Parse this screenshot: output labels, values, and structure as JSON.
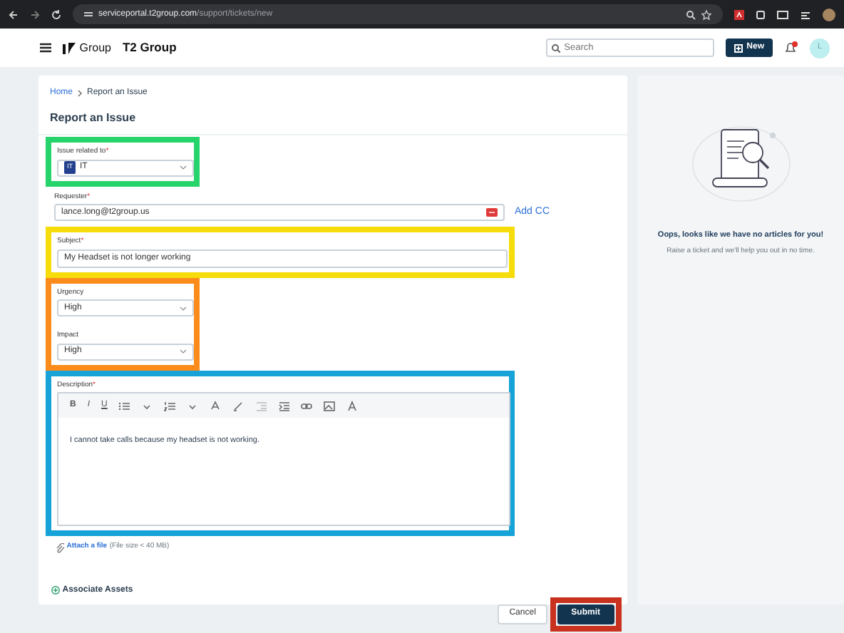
{
  "browser": {
    "url_host": "serviceportal.t2group.com",
    "url_path": "/support/tickets/new"
  },
  "header": {
    "logo_text": "Group",
    "title": "T2 Group",
    "search": {
      "placeholder": "Search"
    },
    "new_button": "New",
    "avatar_initial": "L"
  },
  "breadcrumb": [
    {
      "label": "Home",
      "kind": "link"
    },
    {
      "label": "Report an Issue",
      "kind": "current"
    }
  ],
  "page_title": "Report an Issue",
  "sections": [
    {
      "color": "#27d36b",
      "fields": [
        {
          "kind": "select",
          "label": "Issue related to",
          "mark": "*",
          "badge": "IT",
          "value": "IT"
        }
      ]
    },
    {
      "fields": [
        {
          "kind": "email",
          "label": "Requester",
          "mark": "*",
          "value": "lance.long@t2group.us",
          "action": "Add CC"
        }
      ]
    },
    {
      "color": "#f5dc0a",
      "fields": [
        {
          "kind": "text",
          "label": "Subject",
          "mark": "*",
          "value": "My Headset is not longer working"
        }
      ]
    },
    {
      "color": "#fb8c1c",
      "fields": [
        {
          "kind": "select",
          "label": "Urgency",
          "value": "High"
        },
        {
          "kind": "select",
          "label": "Impact",
          "value": "High"
        }
      ]
    },
    {
      "color": "#17a3d8",
      "fields": [
        {
          "kind": "editor",
          "label": "Description",
          "mark": "*",
          "toolbar": [
            "B",
            "I",
            "U"
          ],
          "value": "I cannot take calls because my headset is not working."
        }
      ]
    }
  ],
  "attachment": {
    "link": "Attach a file",
    "note": "(File size < 40 MB)"
  },
  "associate": "Associate Assets",
  "buttons": [
    {
      "label": "Cancel",
      "kind": "secondary"
    },
    {
      "label": "Submit",
      "kind": "primary",
      "color": "#c8321e"
    }
  ],
  "sidebar": {
    "title": "Oops, looks like we have no articles for you!",
    "text": "Raise a ticket and we'll help you out in no time."
  }
}
